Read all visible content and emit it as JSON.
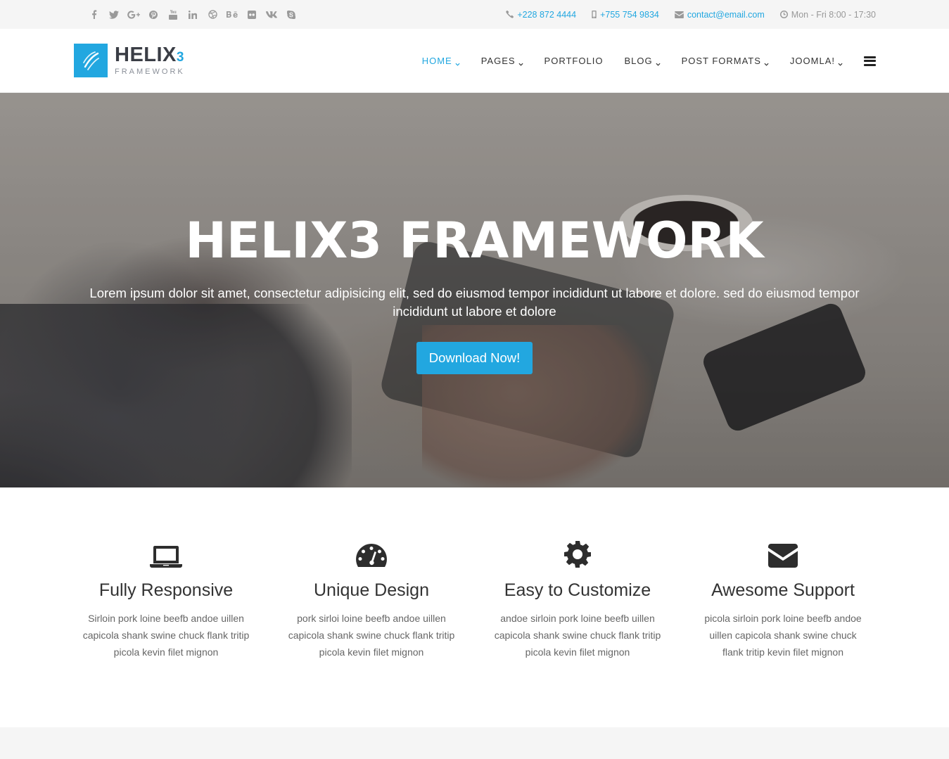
{
  "topbar": {
    "social": [
      {
        "name": "facebook-icon"
      },
      {
        "name": "twitter-icon"
      },
      {
        "name": "google-plus-icon"
      },
      {
        "name": "pinterest-icon"
      },
      {
        "name": "youtube-icon"
      },
      {
        "name": "linkedin-icon"
      },
      {
        "name": "dribbble-icon"
      },
      {
        "name": "behance-icon",
        "glyph": "Bē"
      },
      {
        "name": "flickr-icon"
      },
      {
        "name": "vk-icon"
      },
      {
        "name": "skype-icon"
      }
    ],
    "contact": {
      "phone": "+228 872 4444",
      "mobile": "+755 754 9834",
      "email": "contact@email.com",
      "hours": "Mon - Fri 8:00 - 17:30"
    }
  },
  "header": {
    "logo": {
      "title": "HELIX",
      "title_number": "3",
      "subtitle": "FRAMEWORK"
    },
    "nav": [
      {
        "label": "HOME",
        "dropdown": true,
        "active": true
      },
      {
        "label": "PAGES",
        "dropdown": true,
        "active": false
      },
      {
        "label": "PORTFOLIO",
        "dropdown": false,
        "active": false
      },
      {
        "label": "BLOG",
        "dropdown": true,
        "active": false
      },
      {
        "label": "POST FORMATS",
        "dropdown": true,
        "active": false
      },
      {
        "label": "JOOMLA!",
        "dropdown": true,
        "active": false
      }
    ]
  },
  "hero": {
    "title": "HELIX3 FRAMEWORK",
    "text": "Lorem ipsum dolor sit amet, consectetur adipisicing elit, sed do eiusmod tempor incididunt ut labore et dolore. sed do eiusmod tempor incididunt ut labore et dolore",
    "button": "Download Now!"
  },
  "features": [
    {
      "icon": "laptop-icon",
      "title": "Fully Responsive",
      "text": "Sirloin pork loine beefb andoe uillen capicola shank swine chuck flank tritip picola kevin filet mignon"
    },
    {
      "icon": "dashboard-icon",
      "title": "Unique Design",
      "text": "pork sirloi loine beefb andoe uillen capicola shank swine chuck flank tritip picola kevin filet mignon"
    },
    {
      "icon": "gear-icon",
      "title": "Easy to Customize",
      "text": "andoe sirloin pork loine beefb uillen capicola shank swine chuck flank tritip picola kevin filet mignon"
    },
    {
      "icon": "envelope-icon",
      "title": "Awesome Support",
      "text": "picola sirloin pork loine beefb andoe uillen capicola shank swine chuck flank tritip kevin filet mignon"
    }
  ],
  "colors": {
    "accent": "#22a7e0",
    "topbar_bg": "#f5f5f5",
    "text": "#333333"
  }
}
